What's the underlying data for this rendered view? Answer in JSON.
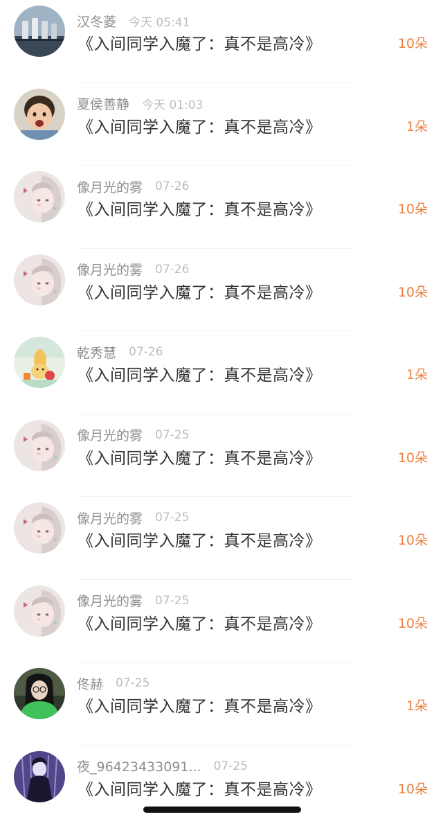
{
  "list": {
    "items": [
      {
        "username": "汉冬菱",
        "time": "今天 05:41",
        "title": "《入间同学入魔了：真不是高冷》",
        "count": "10朵",
        "avatar": "avatar-bottles"
      },
      {
        "username": "夏侯善静",
        "time": "今天 01:03",
        "title": "《入间同学入魔了：真不是高冷》",
        "count": "1朵",
        "avatar": "avatar-child"
      },
      {
        "username": "像月光的雾",
        "time": "07-26",
        "title": "《入间同学入魔了：真不是高冷》",
        "count": "10朵",
        "avatar": "avatar-anime-girl"
      },
      {
        "username": "像月光的雾",
        "time": "07-26",
        "title": "《入间同学入魔了：真不是高冷》",
        "count": "10朵",
        "avatar": "avatar-anime-girl"
      },
      {
        "username": "乾秀慧",
        "time": "07-26",
        "title": "《入间同学入魔了：真不是高冷》",
        "count": "1朵",
        "avatar": "avatar-cartoon"
      },
      {
        "username": "像月光的雾",
        "time": "07-25",
        "title": "《入间同学入魔了：真不是高冷》",
        "count": "10朵",
        "avatar": "avatar-anime-girl"
      },
      {
        "username": "像月光的雾",
        "time": "07-25",
        "title": "《入间同学入魔了：真不是高冷》",
        "count": "10朵",
        "avatar": "avatar-anime-girl"
      },
      {
        "username": "像月光的雾",
        "time": "07-25",
        "title": "《入间同学入魔了：真不是高冷》",
        "count": "10朵",
        "avatar": "avatar-anime-girl"
      },
      {
        "username": "佟赫",
        "time": "07-25",
        "title": "《入间同学入魔了：真不是高冷》",
        "count": "1朵",
        "avatar": "avatar-green-girl"
      },
      {
        "username": "夜_96423433091...",
        "time": "07-25",
        "title": "《入间同学入魔了：真不是高冷》",
        "count": "10朵",
        "avatar": "avatar-dark-figure"
      }
    ]
  },
  "colors": {
    "accent": "#ee8040",
    "username": "#8e8e8e",
    "time": "#bdbdbd",
    "title": "#333333"
  }
}
